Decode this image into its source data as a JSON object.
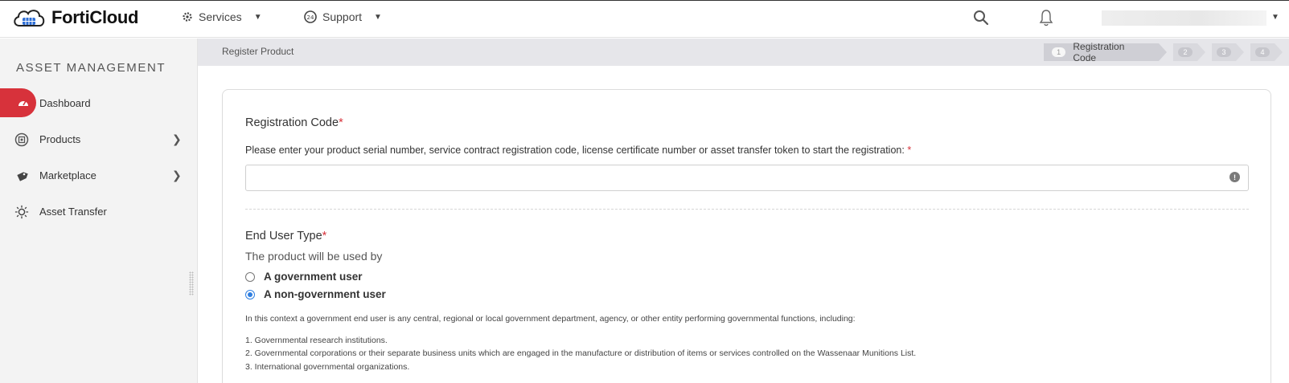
{
  "header": {
    "brand": "FortiCloud",
    "nav": [
      {
        "label": "Services",
        "icon": "gear-cluster-icon"
      },
      {
        "label": "Support",
        "icon": "support-headset-icon"
      }
    ],
    "search_icon": "search-icon",
    "bell_icon": "bell-icon"
  },
  "sidebar": {
    "title": "ASSET MANAGEMENT",
    "items": [
      {
        "label": "Dashboard",
        "icon": "speedometer-icon",
        "active": true
      },
      {
        "label": "Products",
        "icon": "globe-chip-icon",
        "has_children": true
      },
      {
        "label": "Marketplace",
        "icon": "tag-icon",
        "has_children": true
      },
      {
        "label": "Asset Transfer",
        "icon": "transfer-gear-icon"
      }
    ]
  },
  "breadcrumb": {
    "label": "Register Product"
  },
  "steps": [
    {
      "number": "1",
      "label": "Registration Code",
      "current": true
    },
    {
      "number": "2",
      "label": ""
    },
    {
      "number": "3",
      "label": ""
    },
    {
      "number": "4",
      "label": ""
    }
  ],
  "form": {
    "registration_title": "Registration Code",
    "registration_help": "Please enter your product serial number, service contract registration code, license certificate number or asset transfer token to start the registration:",
    "registration_value": "",
    "registration_placeholder": "",
    "end_user_title": "End User Type",
    "end_user_subtitle": "The product will be used by",
    "options": [
      {
        "label": "A government user",
        "checked": false
      },
      {
        "label": "A non-government user",
        "checked": true
      }
    ],
    "context_text": "In this context a government end user is any central, regional or local government department, agency, or other entity performing governmental functions, including:",
    "list": [
      "1. Governmental research institutions.",
      "2. Governmental corporations or their separate business units which are engaged in the manufacture or distribution of items or services controlled on the Wassenaar Munitions List.",
      "3. International governmental organizations."
    ]
  },
  "colors": {
    "accent_red": "#d7323b",
    "radio_blue": "#2f7fe0"
  }
}
